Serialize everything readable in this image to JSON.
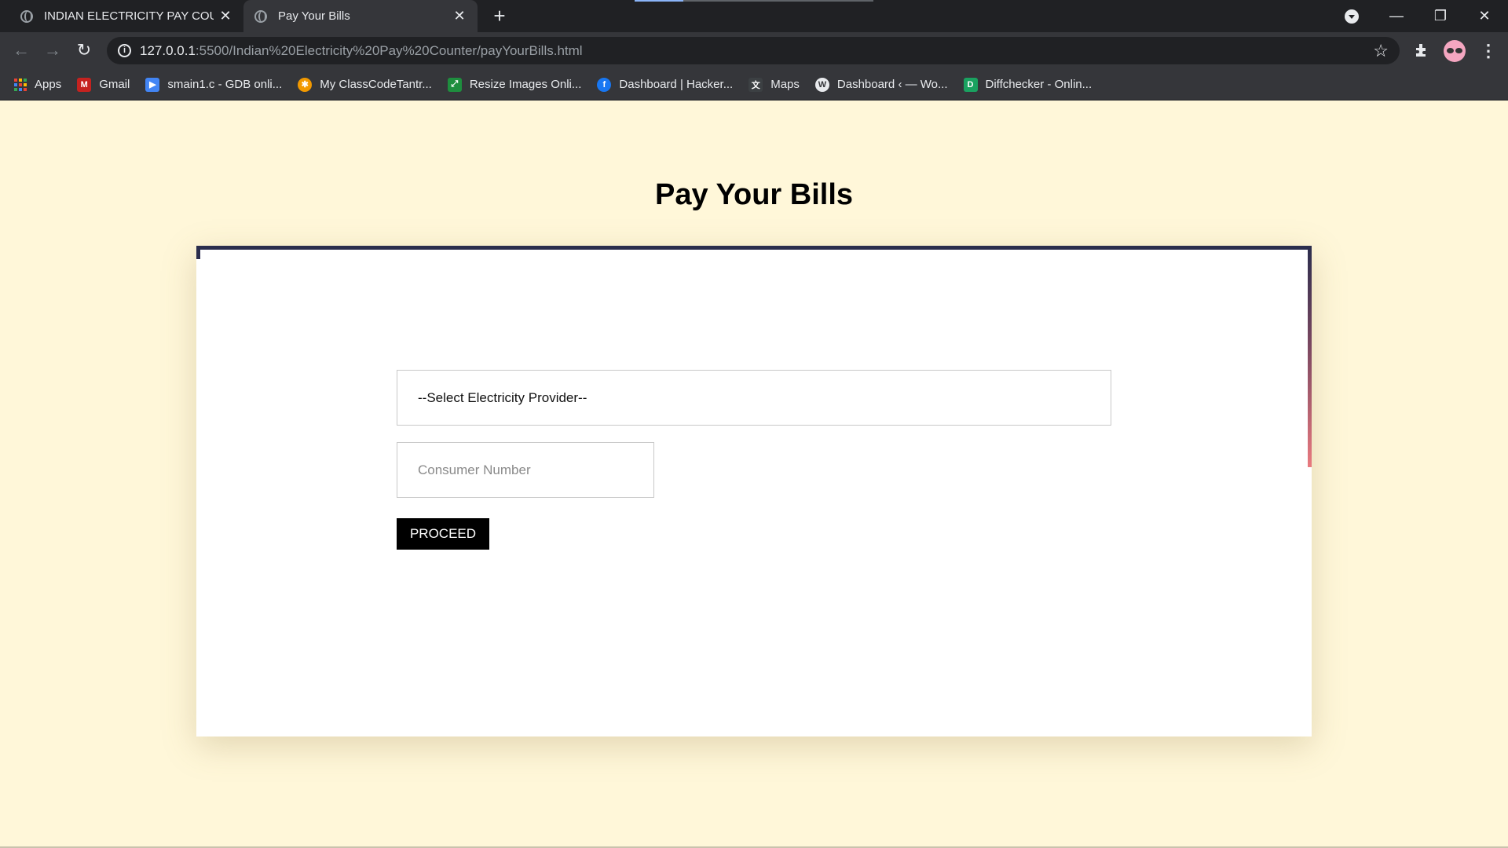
{
  "browser": {
    "tabs": [
      {
        "title": "INDIAN ELECTRICITY PAY COUNTER",
        "close": "✕"
      },
      {
        "title": "Pay Your Bills",
        "close": "✕"
      }
    ],
    "new_tab": "+",
    "window_controls": {
      "minimize": "—",
      "restore": "❐",
      "close": "✕"
    },
    "url_host": "127.0.0.1",
    "url_path": ":5500/Indian%20Electricity%20Pay%20Counter/payYourBills.html",
    "info_icon": "i",
    "star_icon": "☆",
    "menu_icon": "⋮"
  },
  "bookmarks": [
    {
      "label": "Apps",
      "icon": "apps-grid-icon"
    },
    {
      "label": "Gmail",
      "icon": "gmail-icon",
      "color": "#c5221f"
    },
    {
      "label": "smain1.c - GDB onli...",
      "icon": "gdb-icon",
      "color": "#4285f4"
    },
    {
      "label": "My ClassCodeTantr...",
      "icon": "classcode-icon",
      "color": "#f29900"
    },
    {
      "label": "Resize Images Onli...",
      "icon": "resize-icon",
      "color": "#1e8e3e"
    },
    {
      "label": "Dashboard | Hacker...",
      "icon": "facebook-icon",
      "color": "#1877f2"
    },
    {
      "label": "Maps",
      "icon": "maps-icon",
      "color": "#3c4043"
    },
    {
      "label": "Dashboard ‹ — Wo...",
      "icon": "wordpress-icon",
      "color": "#e8eaed"
    },
    {
      "label": "Diffchecker - Onlin...",
      "icon": "diffchecker-icon",
      "color": "#1aa260"
    }
  ],
  "page": {
    "title": "Pay Your Bills",
    "provider_select": "--Select Electricity Provider--",
    "consumer_placeholder": "Consumer Number",
    "proceed_label": "PROCEED"
  },
  "colors": {
    "page_background": "#fff7d9",
    "card_border_dark": "#2a2d4d",
    "card_border_accent": "#e97a7f",
    "button": "#000000"
  }
}
